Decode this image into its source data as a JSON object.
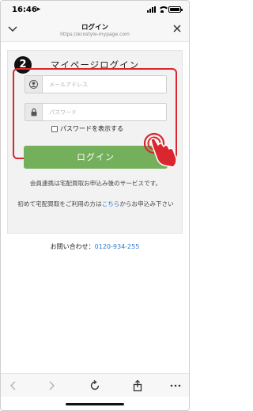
{
  "status_bar": {
    "time": "16:46",
    "location_arrow": "location-arrow-icon",
    "battery_level": 1.0
  },
  "browser_header": {
    "title": "ログイン",
    "url": "https://ecostyle-mypage.com"
  },
  "login": {
    "step_badge": "2",
    "heading": "マイページログイン",
    "email_placeholder": "メールアドレス",
    "password_placeholder": "パスワード",
    "show_password_label": "パスワードを表示する",
    "show_password_checked": false,
    "login_button": "ログイン"
  },
  "notes": {
    "line1": "会員連携は宅配買取お申込み後のサービスです。",
    "line2_prefix": "初めて宅配買取をご利用の方は",
    "line2_link": "こちら",
    "line2_suffix": "からお申込み下さい"
  },
  "contact": {
    "label": "お問い合わせ：",
    "phone": "0120-934-255"
  },
  "colors": {
    "accent_green": "#74b05c",
    "highlight_red": "#d9262f",
    "link_blue": "#2f78c7"
  }
}
